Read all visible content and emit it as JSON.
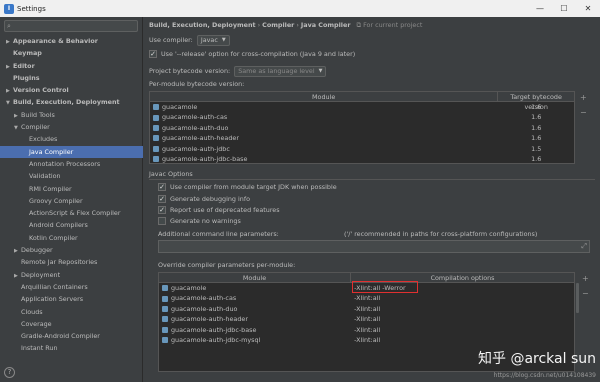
{
  "window": {
    "title": "Settings",
    "minimize": "—",
    "maximize": "☐",
    "close": "✕"
  },
  "search": {
    "placeholder": ""
  },
  "tree": [
    {
      "label": "Appearance & Behavior",
      "arrow": "▶",
      "indent": 0,
      "bold": true
    },
    {
      "label": "Keymap",
      "arrow": "",
      "indent": 0,
      "bold": true
    },
    {
      "label": "Editor",
      "arrow": "▶",
      "indent": 0,
      "bold": true
    },
    {
      "label": "Plugins",
      "arrow": "",
      "indent": 0,
      "bold": true
    },
    {
      "label": "Version Control",
      "arrow": "▶",
      "indent": 0,
      "bold": true
    },
    {
      "label": "Build, Execution, Deployment",
      "arrow": "▼",
      "indent": 0,
      "bold": true
    },
    {
      "label": "Build Tools",
      "arrow": "▶",
      "indent": 1,
      "bold": false
    },
    {
      "label": "Compiler",
      "arrow": "▼",
      "indent": 1,
      "bold": false
    },
    {
      "label": "Excludes",
      "arrow": "",
      "indent": 2,
      "bold": false
    },
    {
      "label": "Java Compiler",
      "arrow": "",
      "indent": 2,
      "bold": false,
      "selected": true
    },
    {
      "label": "Annotation Processors",
      "arrow": "",
      "indent": 2,
      "bold": false
    },
    {
      "label": "Validation",
      "arrow": "",
      "indent": 2,
      "bold": false
    },
    {
      "label": "RMI Compiler",
      "arrow": "",
      "indent": 2,
      "bold": false
    },
    {
      "label": "Groovy Compiler",
      "arrow": "",
      "indent": 2,
      "bold": false
    },
    {
      "label": "ActionScript & Flex Compiler",
      "arrow": "",
      "indent": 2,
      "bold": false
    },
    {
      "label": "Android Compilers",
      "arrow": "",
      "indent": 2,
      "bold": false
    },
    {
      "label": "Kotlin Compiler",
      "arrow": "",
      "indent": 2,
      "bold": false
    },
    {
      "label": "Debugger",
      "arrow": "▶",
      "indent": 1,
      "bold": false
    },
    {
      "label": "Remote Jar Repositories",
      "arrow": "",
      "indent": 1,
      "bold": false
    },
    {
      "label": "Deployment",
      "arrow": "▶",
      "indent": 1,
      "bold": false
    },
    {
      "label": "Arquillian Containers",
      "arrow": "",
      "indent": 1,
      "bold": false
    },
    {
      "label": "Application Servers",
      "arrow": "",
      "indent": 1,
      "bold": false
    },
    {
      "label": "Clouds",
      "arrow": "",
      "indent": 1,
      "bold": false
    },
    {
      "label": "Coverage",
      "arrow": "",
      "indent": 1,
      "bold": false
    },
    {
      "label": "Gradle-Android Compiler",
      "arrow": "",
      "indent": 1,
      "bold": false
    },
    {
      "label": "Instant Run",
      "arrow": "",
      "indent": 1,
      "bold": false
    }
  ],
  "help": "?",
  "breadcrumb": {
    "p1": "Build, Execution, Deployment",
    "sep": "›",
    "p2": "Compiler",
    "p3": "Java Compiler",
    "project": "For current project"
  },
  "compiler": {
    "label": "Use compiler:",
    "value": "Javac"
  },
  "release_option": {
    "checked": true,
    "label": "Use '--release' option for cross-compilation (Java 9 and later)"
  },
  "bytecode": {
    "label": "Project bytecode version:",
    "value": "Same as language level"
  },
  "per_module_label": "Per-module bytecode version:",
  "bytecode_table": {
    "headers": [
      "Module",
      "Target bytecode version"
    ],
    "rows": [
      [
        "guacamole",
        "1.6"
      ],
      [
        "guacamole-auth-cas",
        "1.6"
      ],
      [
        "guacamole-auth-duo",
        "1.6"
      ],
      [
        "guacamole-auth-header",
        "1.6"
      ],
      [
        "guacamole-auth-jdbc",
        "1.5"
      ],
      [
        "guacamole-auth-jdbc-base",
        "1.6"
      ]
    ],
    "add": "+",
    "remove": "−"
  },
  "javac_options": {
    "title": "Javac Options",
    "checks": [
      {
        "checked": true,
        "label": "Use compiler from module target JDK when possible"
      },
      {
        "checked": true,
        "label": "Generate debugging info"
      },
      {
        "checked": true,
        "label": "Report use of deprecated features"
      },
      {
        "checked": false,
        "label": "Generate no warnings"
      }
    ],
    "additional_label": "Additional command line parameters:",
    "additional_hint": "('/' recommended in paths for cross-platform configurations)",
    "override_label": "Override compiler parameters per-module:"
  },
  "override_table": {
    "headers": [
      "Module",
      "Compilation options"
    ],
    "rows": [
      [
        "guacamole",
        "-Xlint:all -Werror"
      ],
      [
        "guacamole-auth-cas",
        "-Xlint:all"
      ],
      [
        "guacamole-auth-duo",
        "-Xlint:all"
      ],
      [
        "guacamole-auth-header",
        "-Xlint:all"
      ],
      [
        "guacamole-auth-jdbc-base",
        "-Xlint:all"
      ],
      [
        "guacamole-auth-jdbc-mysql",
        "-Xlint:all"
      ]
    ],
    "add": "+",
    "remove": "−"
  },
  "watermark": {
    "text": "知乎 @arckal sun",
    "url": "https://blog.csdn.net/u014108439"
  }
}
